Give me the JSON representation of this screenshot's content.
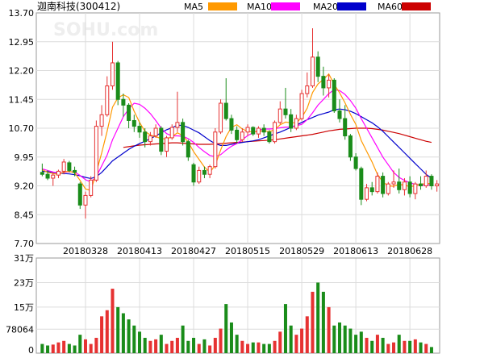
{
  "chart_data": [
    {
      "type": "candlestick",
      "title": "迦南科技(300412)",
      "watermark": "SOHU.com",
      "legend": [
        {
          "name": "MA5",
          "color": "#ff9900"
        },
        {
          "name": "MA10",
          "color": "#ff00ff"
        },
        {
          "name": "MA20",
          "color": "#0000cc"
        },
        {
          "name": "MA60",
          "color": "#cc0000"
        }
      ],
      "colors": {
        "up": "#e63232",
        "down": "#1a8c1a"
      },
      "y_ticks": [
        "13.70",
        "12.95",
        "12.20",
        "11.45",
        "10.70",
        "9.95",
        "9.20",
        "8.45",
        "7.70"
      ],
      "ylim": [
        7.7,
        13.7
      ],
      "x_ticks": [
        {
          "index": 8,
          "label": "20180328"
        },
        {
          "index": 18,
          "label": "20180413"
        },
        {
          "index": 28,
          "label": "20180427"
        },
        {
          "index": 38,
          "label": "20180515"
        },
        {
          "index": 48,
          "label": "20180529"
        },
        {
          "index": 58,
          "label": "20180613"
        },
        {
          "index": 68,
          "label": "20180628"
        }
      ],
      "candles": [
        [
          9.55,
          9.78,
          9.45,
          9.5
        ],
        [
          9.5,
          9.6,
          9.35,
          9.4
        ],
        [
          9.4,
          9.55,
          9.2,
          9.48
        ],
        [
          9.48,
          9.62,
          9.4,
          9.58
        ],
        [
          9.58,
          9.9,
          9.5,
          9.82
        ],
        [
          9.8,
          9.85,
          9.55,
          9.6
        ],
        [
          9.6,
          9.7,
          9.45,
          9.55
        ],
        [
          9.25,
          9.3,
          8.6,
          8.7
        ],
        [
          8.7,
          9.05,
          8.35,
          8.95
        ],
        [
          8.95,
          9.45,
          8.9,
          9.35
        ],
        [
          9.35,
          10.9,
          9.3,
          10.75
        ],
        [
          10.75,
          11.3,
          10.5,
          11.05
        ],
        [
          11.05,
          12.05,
          11.0,
          11.8
        ],
        [
          11.8,
          12.95,
          11.7,
          12.4
        ],
        [
          12.4,
          12.45,
          11.3,
          11.45
        ],
        [
          11.45,
          11.6,
          11.0,
          11.3
        ],
        [
          11.3,
          11.35,
          10.7,
          10.9
        ],
        [
          10.9,
          11.05,
          10.6,
          10.75
        ],
        [
          10.75,
          10.85,
          10.45,
          10.6
        ],
        [
          10.6,
          10.7,
          10.2,
          10.35
        ],
        [
          10.35,
          10.6,
          10.25,
          10.5
        ],
        [
          10.5,
          10.8,
          10.45,
          10.7
        ],
        [
          10.7,
          10.75,
          10.0,
          10.1
        ],
        [
          10.1,
          10.5,
          9.95,
          10.45
        ],
        [
          10.45,
          10.8,
          10.4,
          10.72
        ],
        [
          10.72,
          11.65,
          10.6,
          10.85
        ],
        [
          10.85,
          10.95,
          10.25,
          10.35
        ],
        [
          10.35,
          10.4,
          9.85,
          9.95
        ],
        [
          9.75,
          9.8,
          9.2,
          9.3
        ],
        [
          9.3,
          9.7,
          9.25,
          9.6
        ],
        [
          9.6,
          9.7,
          9.4,
          9.5
        ],
        [
          9.5,
          9.75,
          9.4,
          9.7
        ],
        [
          9.7,
          10.7,
          9.65,
          10.6
        ],
        [
          10.6,
          11.45,
          10.55,
          11.35
        ],
        [
          11.35,
          12.0,
          10.9,
          10.95
        ],
        [
          10.95,
          11.05,
          10.55,
          10.65
        ],
        [
          10.65,
          10.75,
          10.3,
          10.4
        ],
        [
          10.4,
          10.7,
          10.35,
          10.6
        ],
        [
          10.6,
          10.8,
          10.5,
          10.72
        ],
        [
          10.72,
          10.75,
          10.5,
          10.55
        ],
        [
          10.55,
          10.75,
          10.45,
          10.7
        ],
        [
          10.7,
          10.8,
          10.5,
          10.6
        ],
        [
          10.6,
          10.65,
          10.3,
          10.35
        ],
        [
          10.35,
          10.9,
          10.3,
          10.85
        ],
        [
          10.85,
          11.4,
          10.8,
          11.2
        ],
        [
          11.2,
          11.75,
          10.95,
          11.05
        ],
        [
          11.05,
          11.2,
          10.6,
          10.7
        ],
        [
          10.7,
          11.05,
          10.65,
          10.95
        ],
        [
          10.95,
          11.7,
          10.9,
          11.6
        ],
        [
          11.6,
          12.15,
          11.5,
          11.8
        ],
        [
          11.8,
          13.3,
          11.75,
          12.55
        ],
        [
          12.55,
          12.7,
          11.9,
          12.05
        ],
        [
          12.05,
          12.3,
          11.55,
          11.75
        ],
        [
          11.75,
          12.1,
          11.5,
          11.95
        ],
        [
          11.95,
          12.0,
          11.1,
          11.15
        ],
        [
          11.15,
          11.45,
          10.85,
          10.95
        ],
        [
          10.95,
          11.3,
          10.4,
          10.5
        ],
        [
          10.5,
          10.55,
          9.85,
          9.95
        ],
        [
          9.95,
          10.05,
          9.6,
          9.65
        ],
        [
          9.65,
          9.7,
          8.7,
          8.85
        ],
        [
          8.85,
          9.25,
          8.8,
          9.15
        ],
        [
          9.15,
          9.3,
          8.95,
          9.05
        ],
        [
          9.05,
          9.55,
          9.0,
          9.45
        ],
        [
          9.45,
          9.55,
          8.9,
          9.0
        ],
        [
          9.0,
          9.3,
          8.95,
          9.25
        ],
        [
          9.25,
          9.6,
          9.15,
          9.3
        ],
        [
          9.3,
          9.65,
          9.0,
          9.1
        ],
        [
          9.1,
          9.4,
          8.95,
          9.3
        ],
        [
          9.3,
          9.45,
          8.9,
          9.0
        ],
        [
          9.0,
          9.3,
          8.85,
          9.25
        ],
        [
          9.25,
          9.45,
          9.1,
          9.2
        ],
        [
          9.2,
          9.6,
          9.15,
          9.45
        ],
        [
          9.45,
          9.5,
          9.1,
          9.2
        ],
        [
          9.2,
          9.35,
          9.05,
          9.25
        ]
      ],
      "ma5": [
        9.62,
        9.55,
        9.52,
        9.5,
        9.56,
        9.58,
        9.54,
        9.34,
        9.12,
        9.08,
        9.55,
        10.06,
        10.62,
        11.25,
        11.49,
        11.57,
        11.5,
        11.14,
        10.85,
        10.62,
        10.52,
        10.48,
        10.43,
        10.42,
        10.48,
        10.58,
        10.51,
        10.34,
        10.09,
        9.89,
        9.69,
        9.55,
        9.74,
        10.13,
        10.48,
        10.72,
        10.79,
        10.68,
        10.62,
        10.6,
        10.62,
        10.63,
        10.61,
        10.66,
        10.79,
        10.86,
        10.84,
        10.84,
        10.98,
        11.22,
        11.63,
        11.85,
        11.97,
        12.11,
        11.84,
        11.62,
        11.36,
        11.06,
        10.8,
        10.38,
        10.1,
        9.82,
        9.5,
        9.3,
        9.2,
        9.19,
        9.24,
        9.22,
        9.18,
        9.2,
        9.25,
        9.25,
        9.27
      ],
      "ma10": [
        9.64,
        9.6,
        9.56,
        9.54,
        9.55,
        9.57,
        9.56,
        9.47,
        9.36,
        9.3,
        9.44,
        9.72,
        10.0,
        10.4,
        10.7,
        11.0,
        11.2,
        11.35,
        11.32,
        11.22,
        11.08,
        10.9,
        10.7,
        10.56,
        10.5,
        10.5,
        10.49,
        10.43,
        10.33,
        10.2,
        10.09,
        9.99,
        9.96,
        10.01,
        10.13,
        10.23,
        10.3,
        10.4,
        10.51,
        10.58,
        10.65,
        10.68,
        10.68,
        10.69,
        10.71,
        10.73,
        10.73,
        10.76,
        10.8,
        10.92,
        11.1,
        11.3,
        11.45,
        11.6,
        11.7,
        11.68,
        11.58,
        11.42,
        11.22,
        10.95,
        10.7,
        10.45,
        10.2,
        9.95,
        9.75,
        9.55,
        9.42,
        9.34,
        9.28,
        9.24,
        9.22,
        9.22,
        9.23
      ],
      "ma20": [
        9.58,
        9.57,
        9.55,
        9.53,
        9.52,
        9.51,
        9.49,
        9.46,
        9.42,
        9.39,
        9.44,
        9.55,
        9.7,
        9.85,
        9.95,
        10.05,
        10.15,
        10.23,
        10.3,
        10.36,
        10.43,
        10.5,
        10.58,
        10.66,
        10.71,
        10.78,
        10.77,
        10.72,
        10.65,
        10.58,
        10.48,
        10.38,
        10.3,
        10.25,
        10.25,
        10.28,
        10.31,
        10.33,
        10.35,
        10.37,
        10.4,
        10.45,
        10.5,
        10.55,
        10.6,
        10.66,
        10.72,
        10.78,
        10.85,
        10.92,
        10.98,
        11.04,
        11.08,
        11.12,
        11.18,
        11.2,
        11.18,
        11.14,
        11.08,
        11.0,
        10.92,
        10.84,
        10.74,
        10.62,
        10.48,
        10.34,
        10.2,
        10.06,
        9.92,
        9.78,
        9.64,
        9.5,
        9.4
      ],
      "ma60": [
        null,
        null,
        null,
        null,
        null,
        null,
        null,
        null,
        null,
        null,
        null,
        null,
        null,
        null,
        null,
        10.2,
        10.22,
        10.24,
        10.26,
        10.27,
        10.28,
        10.29,
        10.3,
        10.31,
        10.32,
        10.32,
        10.31,
        10.3,
        10.29,
        10.28,
        10.28,
        10.28,
        10.29,
        10.3,
        10.31,
        10.32,
        10.33,
        10.34,
        10.35,
        10.36,
        10.37,
        10.38,
        10.39,
        10.4,
        10.42,
        10.44,
        10.46,
        10.48,
        10.5,
        10.52,
        10.54,
        10.57,
        10.6,
        10.63,
        10.65,
        10.67,
        10.68,
        10.69,
        10.7,
        10.7,
        10.7,
        10.69,
        10.67,
        10.65,
        10.62,
        10.59,
        10.56,
        10.52,
        10.48,
        10.44,
        10.4,
        10.36,
        10.33
      ]
    },
    {
      "type": "bar",
      "title": "",
      "y_ticks": [
        "31万",
        "23万",
        "15万",
        "78064",
        "0"
      ],
      "ylim": [
        0,
        310000
      ],
      "values": [
        30000,
        25000,
        28000,
        35000,
        40000,
        30000,
        25000,
        60000,
        45000,
        30000,
        50000,
        120000,
        140000,
        210000,
        150000,
        130000,
        110000,
        90000,
        70000,
        50000,
        40000,
        45000,
        60000,
        30000,
        40000,
        50000,
        90000,
        40000,
        50000,
        30000,
        45000,
        25000,
        50000,
        80000,
        160000,
        100000,
        60000,
        40000,
        30000,
        35000,
        35000,
        30000,
        30000,
        40000,
        70000,
        160000,
        90000,
        60000,
        80000,
        120000,
        200000,
        230000,
        200000,
        150000,
        90000,
        100000,
        90000,
        80000,
        60000,
        70000,
        50000,
        40000,
        60000,
        50000,
        30000,
        35000,
        60000,
        40000,
        40000,
        45000,
        35000,
        30000,
        20000
      ]
    }
  ]
}
